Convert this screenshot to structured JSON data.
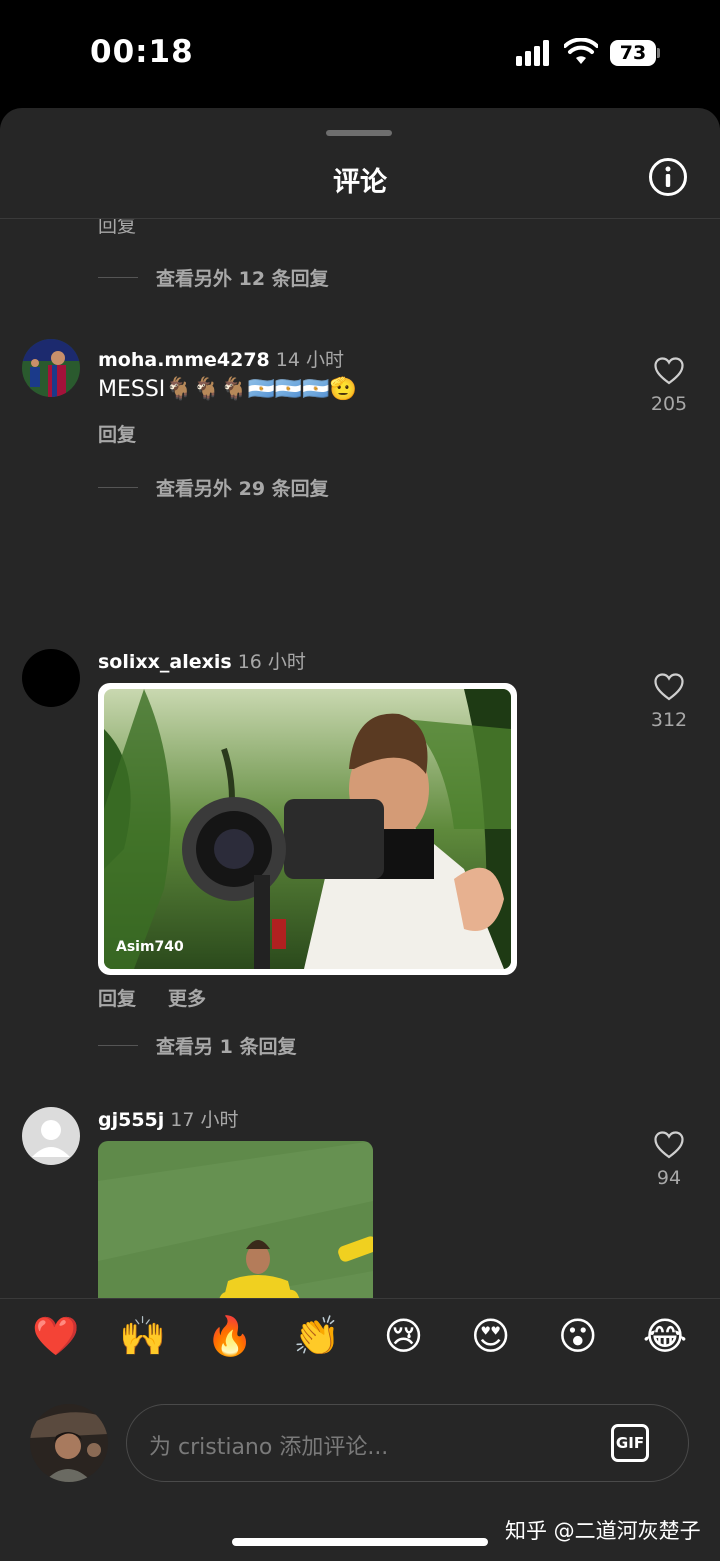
{
  "status_bar": {
    "time": "00:18",
    "battery": "73"
  },
  "header": {
    "title": "评论"
  },
  "partial_reply_label": "回复",
  "first_view_more": "查看另外 12 条回复",
  "comments": [
    {
      "user": "moha.mme4278",
      "time": "14 小时",
      "text": "MESSI🐐🐐🐐🇦🇷🇦🇷🇦🇷🫡",
      "reply": "回复",
      "likes": "205",
      "view_more": "查看另外 29 条回复"
    },
    {
      "user": "solixx_alexis",
      "time": "16 小时",
      "gif_watermark": "Asim740",
      "reply": "回复",
      "more": "更多",
      "likes": "312",
      "view_more": "查看另 1 条回复"
    },
    {
      "user": "gj555j",
      "time": "17 小时",
      "likes": "94"
    }
  ],
  "emojis": [
    "❤️",
    "🙌",
    "🔥",
    "👏",
    "😢",
    "😍",
    "😮",
    "😂"
  ],
  "composer": {
    "placeholder": "为 cristiano 添加评论...",
    "gif_label": "GIF"
  },
  "watermark": "知乎 @二道河灰楚子",
  "colors": {
    "sheet": "#262626",
    "muted": "#a8a8a8",
    "background": "#000000"
  }
}
